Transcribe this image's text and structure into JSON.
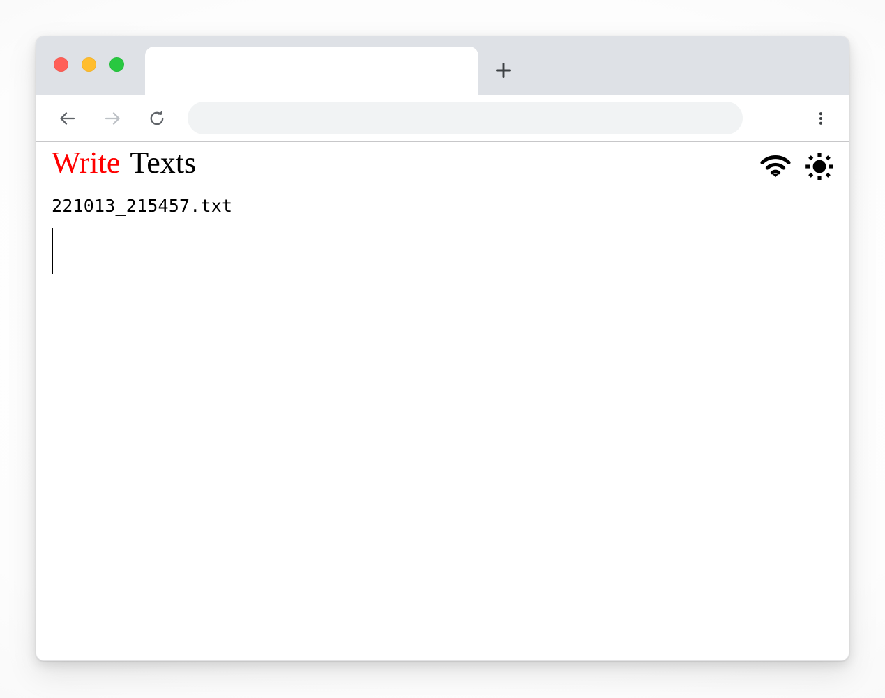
{
  "browser": {
    "traffic_lights": [
      {
        "name": "close",
        "color": "#ff5f57"
      },
      {
        "name": "minimize",
        "color": "#ffbd2e"
      },
      {
        "name": "maximize",
        "color": "#28c840"
      }
    ],
    "tab": {
      "title": "",
      "new_tab_icon": "plus-icon"
    },
    "toolbar": {
      "back_icon": "arrow-left-icon",
      "forward_icon": "arrow-right-icon",
      "reload_icon": "reload-icon",
      "menu_icon": "more-vertical-icon",
      "address_value": "",
      "address_placeholder": ""
    }
  },
  "page": {
    "brand": {
      "first_word": "Write",
      "first_word_color": "#ff0000",
      "second_word": "Texts",
      "second_word_color": "#000000"
    },
    "status_icons": [
      {
        "name": "wifi-icon",
        "label": "wifi"
      },
      {
        "name": "brightness-icon",
        "label": "brightness"
      }
    ],
    "filename": "221013_215457.txt",
    "editor": {
      "content": "",
      "caret_visible": true
    }
  }
}
